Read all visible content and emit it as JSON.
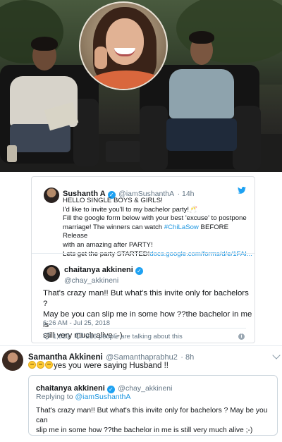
{
  "colors": {
    "accent": "#1da1f2",
    "link": "#1b95e0",
    "text": "#14171a",
    "muted": "#657786",
    "border": "#dcdfe3"
  },
  "icons": {
    "verified": "verified-badge-icon",
    "twitter": "twitter-bird-icon",
    "like": "heart-icon",
    "reply": "speech-bubble-icon",
    "info": "info-icon",
    "menu": "chevron-down-icon",
    "emoji": "thinking-face-emoji"
  },
  "embed_tweet": {
    "author_name": "Sushanth A",
    "author_handle": "@iamSushanthA",
    "time": "· 14h",
    "lines": [
      "HELLO SINGLE BOYS & GIRLS!",
      "I'd like to invite you'll to my bachelor party!🥂",
      "Fill the google form below with your best 'excuse' to postpone",
      "marriage! The winners can watch ",
      "with an amazing after PARTY!",
      "Lets get the party STARTED!"
    ],
    "hashtag": "#ChiLaSow",
    "line4_tail": " BEFORE Release",
    "link": "docs.google.com/forms/d/e/1FAI..."
  },
  "chay_tweet": {
    "author_name": "chaitanya akkineni",
    "author_handle": "@chay_akkineni",
    "text_line1": "That's crazy man!! But what's this invite only for bachelors ?",
    "text_line2": "May be you can slip me in some how ??the bachelor in me is",
    "text_line3": "still very much alive ;-)",
    "timestamp": "6:26 AM - Jul 25, 2018",
    "likes": "1,623",
    "talking": "216 people are talking about this"
  },
  "samantha_reply": {
    "author_name": "Samantha Akkineni",
    "author_handle": "@Samanthaprabhu2",
    "time": "· 8h",
    "text": "yes you were saying Husband !!"
  },
  "quoted_tweet": {
    "author_name": "chaitanya akkineni",
    "author_handle": "@chay_akkineni",
    "replying_to_prefix": "Replying to ",
    "replying_to_handle": "@iamSushanthA",
    "text_line1": "That's crazy man!! But what's this invite only for bachelors ? May be you can",
    "text_line2": "slip me in some how ??the bachelor in me is still very much alive ;-)"
  }
}
